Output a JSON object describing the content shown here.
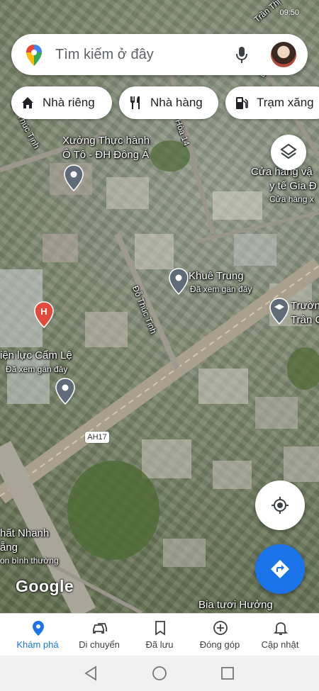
{
  "status_bar": {
    "time": "09:50"
  },
  "search": {
    "placeholder": "Tìm kiếm ở đây"
  },
  "chips": [
    {
      "label": "Nhà riêng",
      "icon": "home-icon"
    },
    {
      "label": "Nhà hàng",
      "icon": "restaurant-icon"
    },
    {
      "label": "Trạm xăng",
      "icon": "gas-station-icon"
    }
  ],
  "map_labels": {
    "street_top": "Trần Thị",
    "street_dotructinh_top": "Đỗ Thúc Tịnh",
    "street_dotructinh_mid": "Đỗ Thúc Tịnh",
    "street_road14": "Hòa 14",
    "street_binh": "Bình",
    "place_xuong_line1": "Xưởng Thực hành",
    "place_xuong_line2": "Ô Tô - ĐH Đông Á",
    "place_cuahang_line1": "Cửa hàng vậ",
    "place_cuahang_line2": "y tế Gia Đ",
    "place_cuahang_sub": "Cửa hàng x",
    "place_khuetrung": "Khuê Trung",
    "place_khuetrung_sub": "Đã xem gần đây",
    "place_truong_line1": "Trườn",
    "place_truong_line2": "Trần C",
    "place_dienluc": "iện lực Cẩm Lệ",
    "place_dienluc_sub": "Đã xem gần đây",
    "highway_shield": "AH17",
    "place_chat_line1": "hất Nhanh",
    "place_chat_line2": "ẵng",
    "place_chat_sub": "on bình thường",
    "place_bia": "Bia tươi Hưởng",
    "google_logo": "Google"
  },
  "bottom_nav": [
    {
      "label": "Khám phá",
      "icon": "explore-pin-icon",
      "active": true
    },
    {
      "label": "Di chuyển",
      "icon": "car-icon",
      "active": false
    },
    {
      "label": "Đã lưu",
      "icon": "bookmark-icon",
      "active": false
    },
    {
      "label": "Đóng góp",
      "icon": "add-circle-icon",
      "active": false
    },
    {
      "label": "Cập nhật",
      "icon": "bell-icon",
      "active": false
    }
  ],
  "colors": {
    "accent": "#1a73e8",
    "pin_gray": "#5f6b78",
    "hospital_red": "#e24a3b"
  }
}
